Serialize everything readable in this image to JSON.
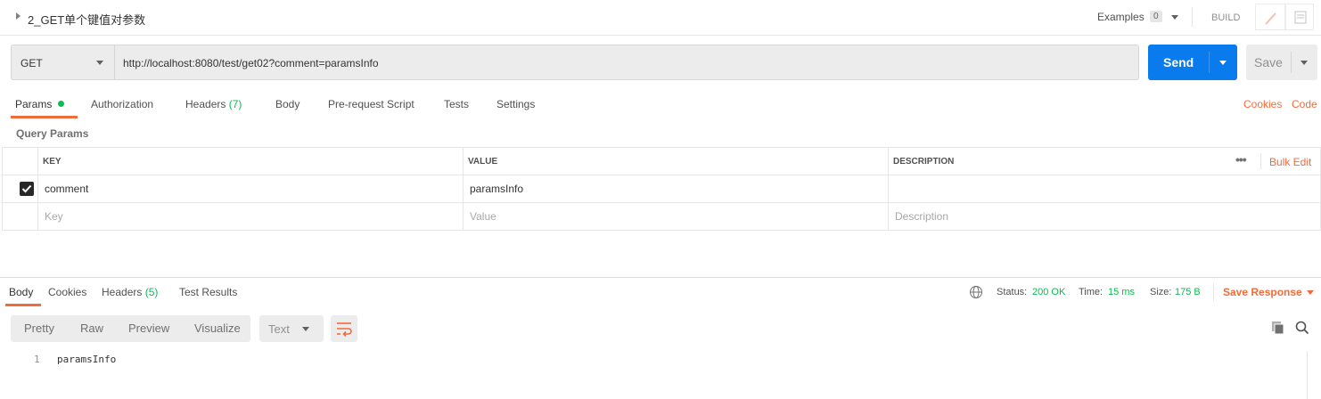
{
  "header": {
    "request_name": "2_GET单个键值对参数",
    "examples_label": "Examples",
    "examples_count": "0",
    "build_label": "BUILD"
  },
  "request": {
    "method": "GET",
    "url": "http://localhost:8080/test/get02?comment=paramsInfo",
    "send_label": "Send",
    "save_label": "Save"
  },
  "tabs": [
    {
      "label": "Params",
      "active": true
    },
    {
      "label": "Authorization"
    },
    {
      "label": "Headers",
      "count": "(7)"
    },
    {
      "label": "Body"
    },
    {
      "label": "Pre-request Script"
    },
    {
      "label": "Tests"
    },
    {
      "label": "Settings"
    }
  ],
  "right_links": {
    "cookies": "Cookies",
    "code": "Code"
  },
  "params": {
    "section_title": "Query Params",
    "columns": {
      "key": "KEY",
      "value": "VALUE",
      "description": "DESCRIPTION"
    },
    "bulk_edit": "Bulk Edit",
    "rows": [
      {
        "checked": true,
        "key": "comment",
        "value": "paramsInfo",
        "description": ""
      }
    ],
    "placeholders": {
      "key": "Key",
      "value": "Value",
      "description": "Description"
    }
  },
  "response": {
    "tabs": [
      {
        "label": "Body",
        "active": true
      },
      {
        "label": "Cookies"
      },
      {
        "label": "Headers",
        "count": "(5)"
      },
      {
        "label": "Test Results"
      }
    ],
    "status_label": "Status:",
    "status_value": "200 OK",
    "time_label": "Time:",
    "time_value": "15 ms",
    "size_label": "Size:",
    "size_value": "175 B",
    "save_response": "Save Response",
    "view_modes": [
      "Pretty",
      "Raw",
      "Preview",
      "Visualize"
    ],
    "format": "Text",
    "lines": [
      {
        "num": "1",
        "text": "paramsInfo"
      }
    ]
  },
  "colors": {
    "accent": "#f26b3a",
    "send": "#097bed",
    "success": "#0cbb52"
  }
}
